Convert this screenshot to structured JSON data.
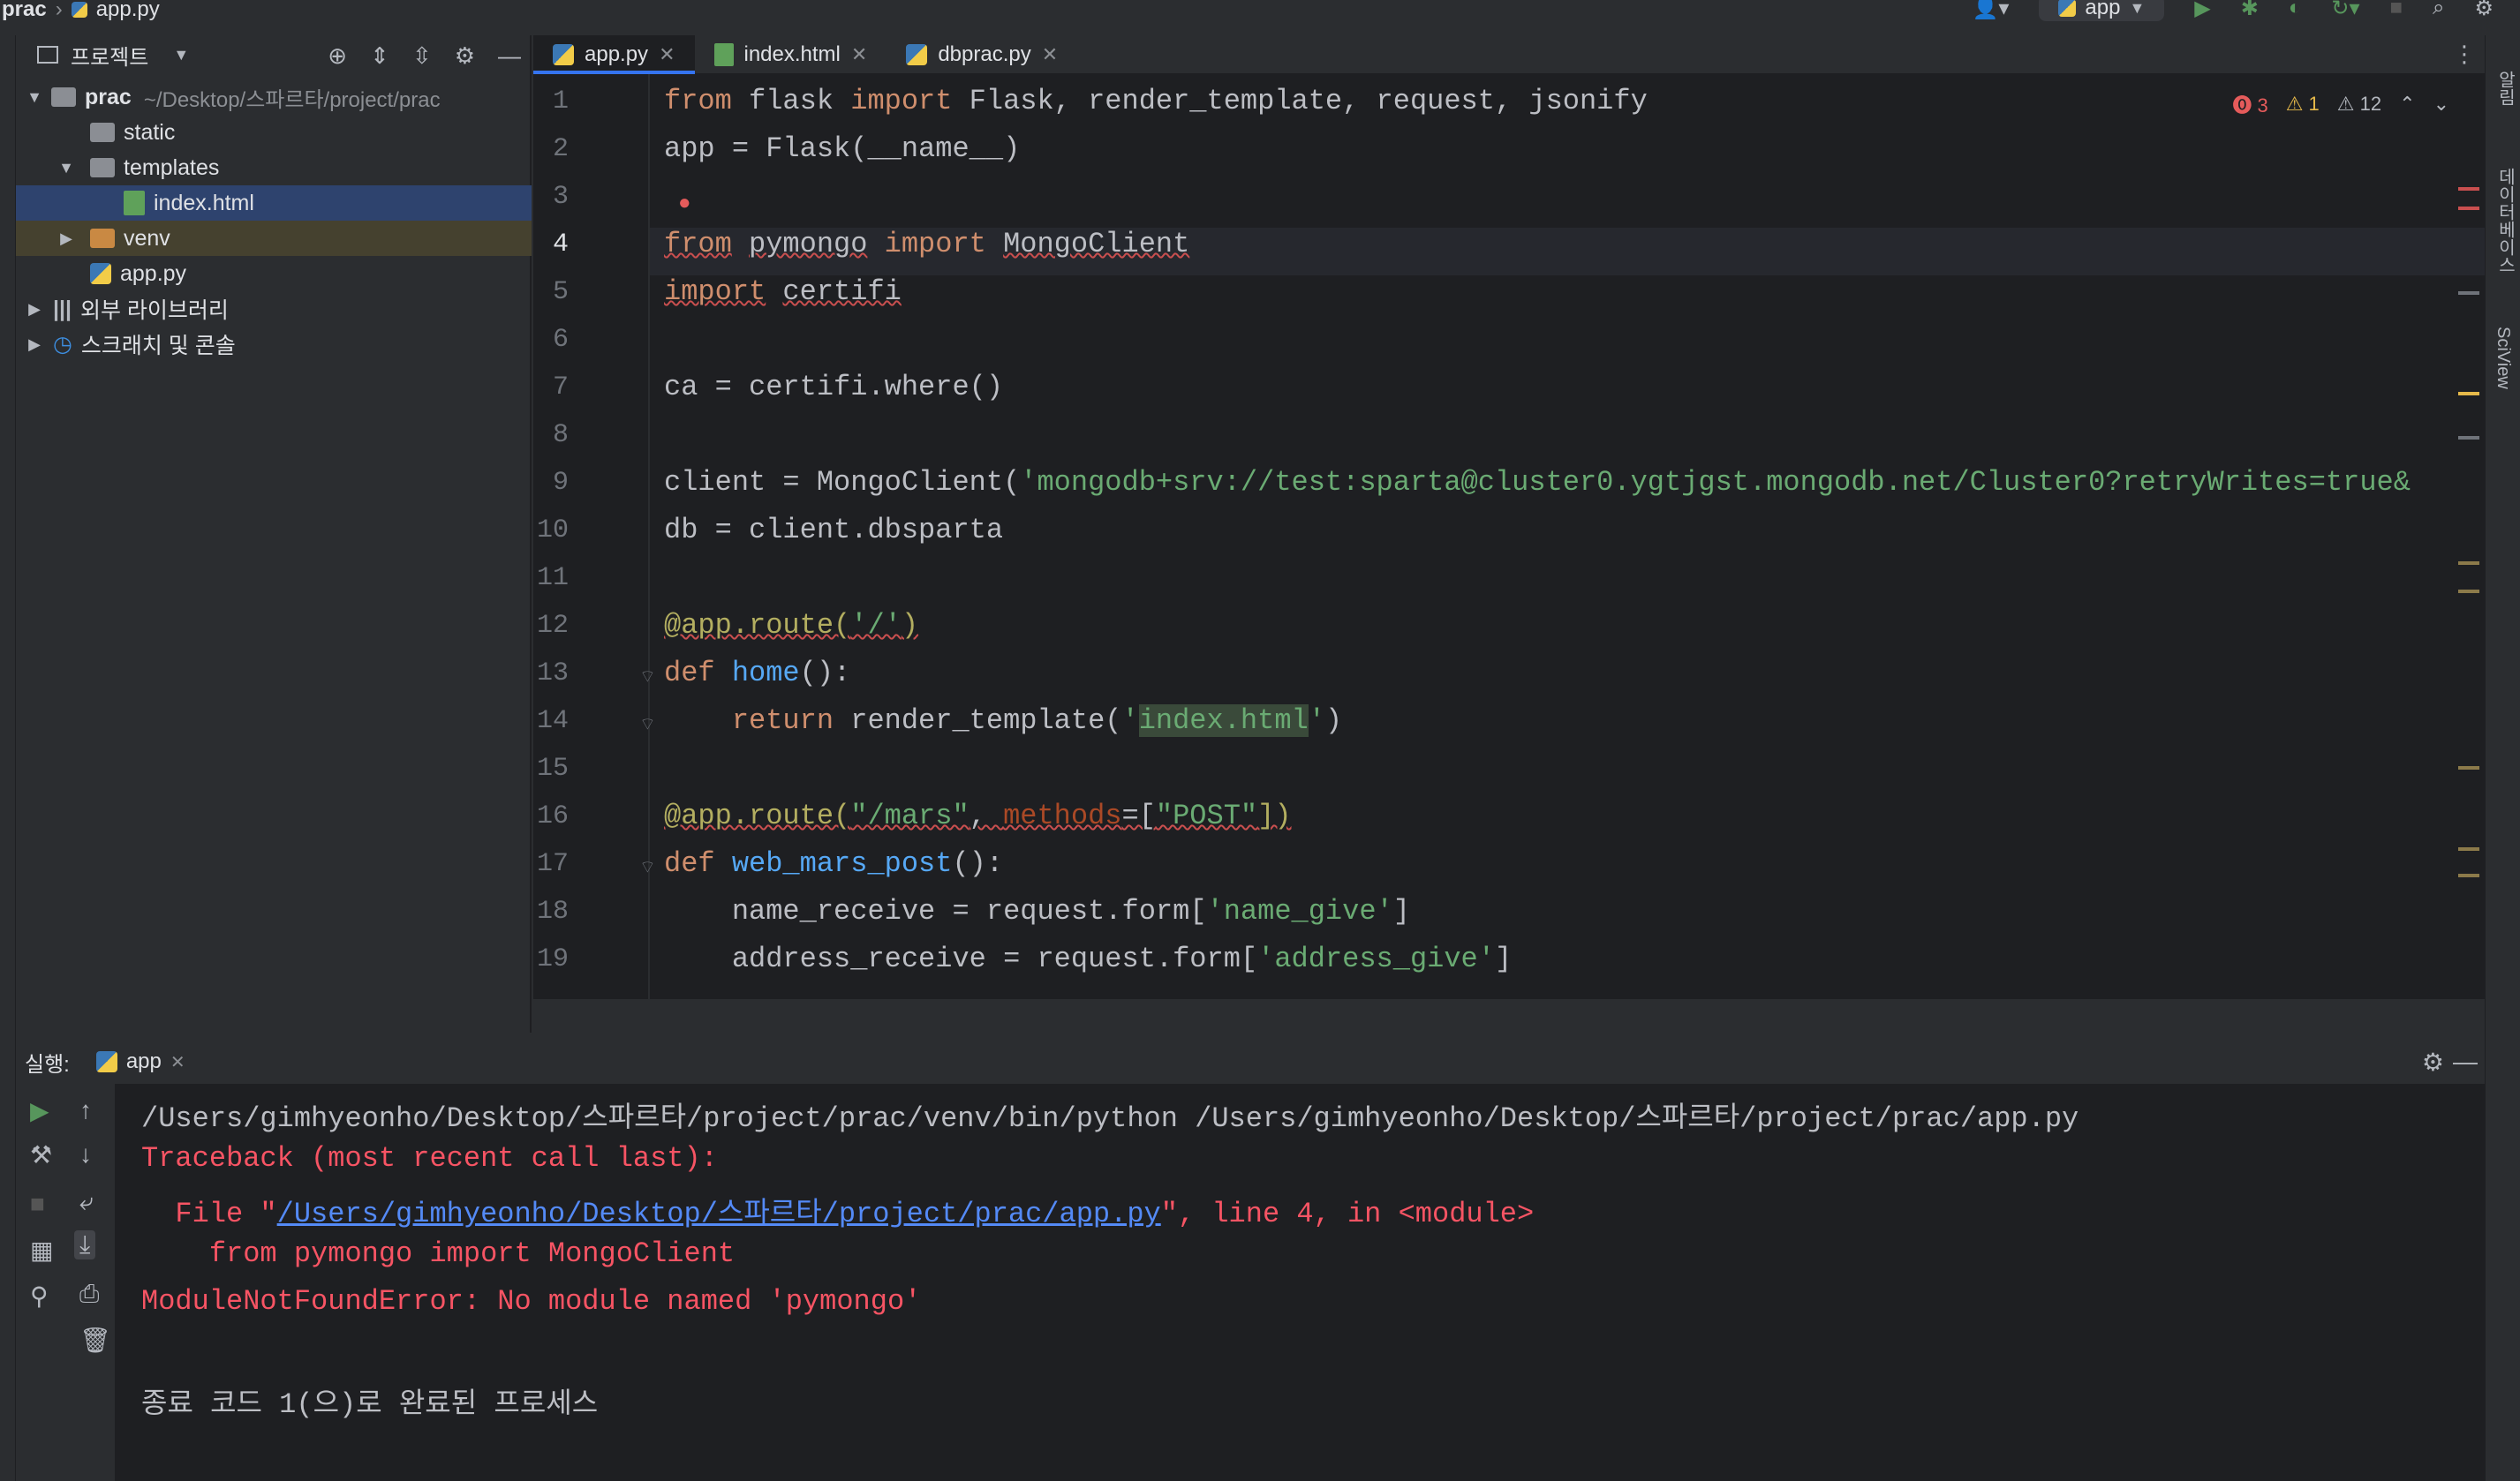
{
  "breadcrumb": {
    "project": "prac",
    "file": "app.py"
  },
  "toolbar": {
    "run_config": "app"
  },
  "project_panel": {
    "title": "프로젝트",
    "tree": [
      {
        "label": "prac",
        "path": "~/Desktop/스파르타/project/prac",
        "type": "folder",
        "expanded": true
      },
      {
        "label": "static",
        "type": "folder"
      },
      {
        "label": "templates",
        "type": "folder",
        "expanded": true
      },
      {
        "label": "index.html",
        "type": "html",
        "selected": true
      },
      {
        "label": "venv",
        "type": "folder-excluded"
      },
      {
        "label": "app.py",
        "type": "python"
      },
      {
        "label": "외부 라이브러리",
        "type": "library"
      },
      {
        "label": "스크래치 및 콘솔",
        "type": "scratch"
      }
    ]
  },
  "tabs": [
    {
      "label": "app.py",
      "active": true
    },
    {
      "label": "index.html",
      "active": false
    },
    {
      "label": "dbprac.py",
      "active": false
    }
  ],
  "inspection": {
    "errors": "3",
    "warnings": "1",
    "weak_warnings": "12"
  },
  "right_tools": {
    "notifications": "알림",
    "database": "데이터베이스",
    "sciview": "SciView"
  },
  "code_lines": [
    "from flask import Flask, render_template, request, jsonify",
    "app = Flask(__name__)",
    "",
    "from pymongo import MongoClient",
    "import certifi",
    "",
    "ca = certifi.where()",
    "",
    "client = MongoClient('mongodb+srv://test:sparta@cluster0.ygtjgst.mongodb.net/Cluster0?retryWrites=true&",
    "db = client.dbsparta",
    "",
    "@app.route('/')",
    "def home():",
    "    return render_template('index.html')",
    "",
    "@app.route(\"/mars\", methods=[\"POST\"])",
    "def web_mars_post():",
    "    name_receive = request.form['name_give']",
    "    address_receive = request.form['address_give']"
  ],
  "line_numbers": [
    "1",
    "2",
    "3",
    "4",
    "5",
    "6",
    "7",
    "8",
    "9",
    "10",
    "11",
    "12",
    "13",
    "14",
    "15",
    "16",
    "17",
    "18",
    "19"
  ],
  "run_panel": {
    "label": "실행:",
    "tab": "app",
    "output": {
      "command": "/Users/gimhyeonho/Desktop/스파르타/project/prac/venv/bin/python /Users/gimhyeonho/Desktop/스파르타/project/prac/app.py",
      "traceback": "Traceback (most recent call last):",
      "file_prefix": "  File \"",
      "file_link": "/Users/gimhyeonho/Desktop/스파르타/project/prac/app.py",
      "file_suffix": "\", line 4, in <module>",
      "source_line": "    from pymongo import MongoClient",
      "error": "ModuleNotFoundError: No module named 'pymongo'",
      "exit": "종료 코드 1(으)로 완료된 프로세스"
    }
  },
  "colors": {
    "accent": "#3574f0",
    "error": "#f75464",
    "string": "#6aab73",
    "keyword": "#cf8e6d"
  }
}
